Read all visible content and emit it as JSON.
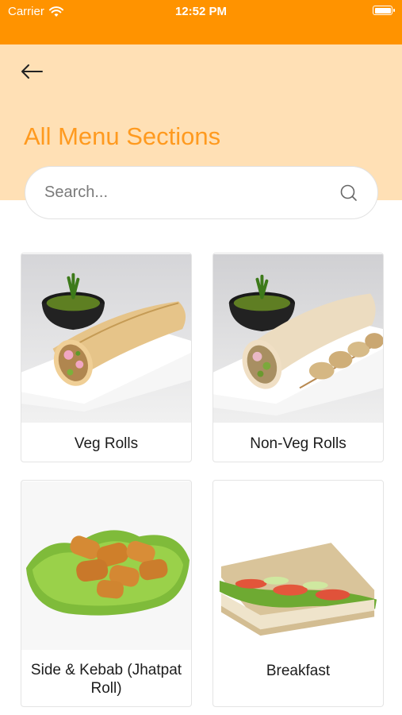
{
  "status_bar": {
    "carrier": "Carrier",
    "time": "12:52 PM"
  },
  "header": {
    "title": "All Menu Sections"
  },
  "search": {
    "placeholder": "Search..."
  },
  "menu_sections": [
    {
      "label": "Veg Rolls",
      "image": "veg-roll-photo"
    },
    {
      "label": "Non-Veg Rolls",
      "image": "non-veg-roll-photo"
    },
    {
      "label": "Side & Kebab (Jhatpat Roll)",
      "image": "kebab-photo"
    },
    {
      "label": "Breakfast",
      "image": "sandwich-photo"
    }
  ],
  "colors": {
    "status_bar": "#ff9300",
    "header_bg": "#ffe0b5",
    "title": "#ff9a1f"
  }
}
